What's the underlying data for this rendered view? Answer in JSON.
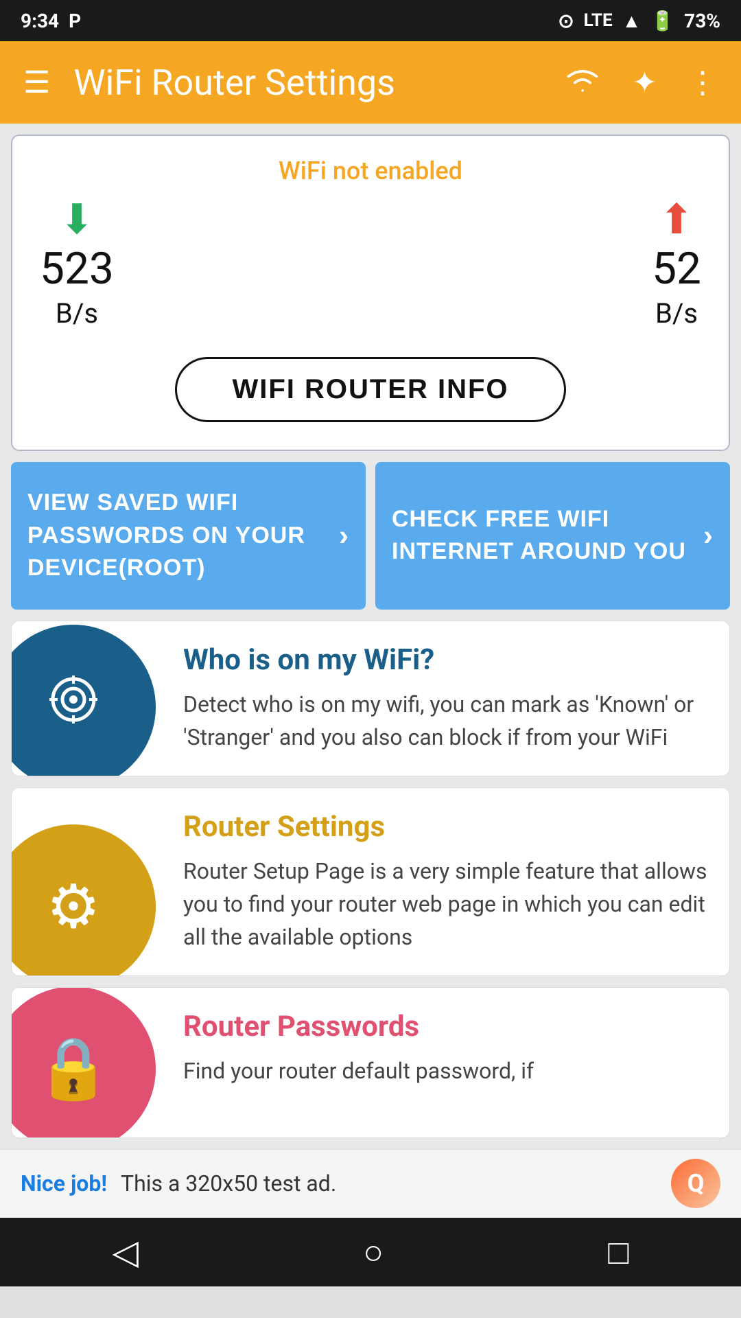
{
  "status_bar": {
    "time": "9:34",
    "parking_icon": "P",
    "signal_icon": "LTE",
    "battery": "73%"
  },
  "app_bar": {
    "title": "WiFi Router Settings",
    "menu_icon": "☰",
    "more_icon": "⋮"
  },
  "speed_card": {
    "wifi_status": "WiFi not enabled",
    "download_value": "523",
    "download_unit": "B/s",
    "upload_value": "52",
    "upload_unit": "B/s",
    "router_info_button": "WIFI ROUTER INFO"
  },
  "buttons": {
    "view_saved_wifi": "VIEW SAVED WIFI PASSWORDS ON YOUR DEVICE(ROOT)",
    "check_free_wifi": "CHECK FREE WIFI INTERNET AROUND YOU",
    "arrow": "›"
  },
  "features": [
    {
      "id": "who-is-on-wifi",
      "title": "Who is on my WiFi?",
      "title_color": "title-blue",
      "circle_color": "circle-blue",
      "icon": "◎",
      "description": "Detect who is on my wifi, you can mark as 'Known' or 'Stranger' and you also can block if from your WiFi"
    },
    {
      "id": "router-settings",
      "title": "Router Settings",
      "title_color": "title-yellow",
      "circle_color": "circle-yellow",
      "icon": "⚙",
      "description": "Router Setup Page is a very simple feature that allows you to find your router web page in which you can edit all the available options"
    },
    {
      "id": "router-passwords",
      "title": "Router Passwords",
      "title_color": "title-pink",
      "circle_color": "circle-pink",
      "icon": "🔒",
      "description": "Find your router default password, if"
    }
  ],
  "ad": {
    "nice_job": "Nice job!",
    "text": "This a 320x50 test ad.",
    "logo": "Q"
  },
  "bottom_nav": {
    "back": "◁",
    "home": "○",
    "recents": "□"
  }
}
